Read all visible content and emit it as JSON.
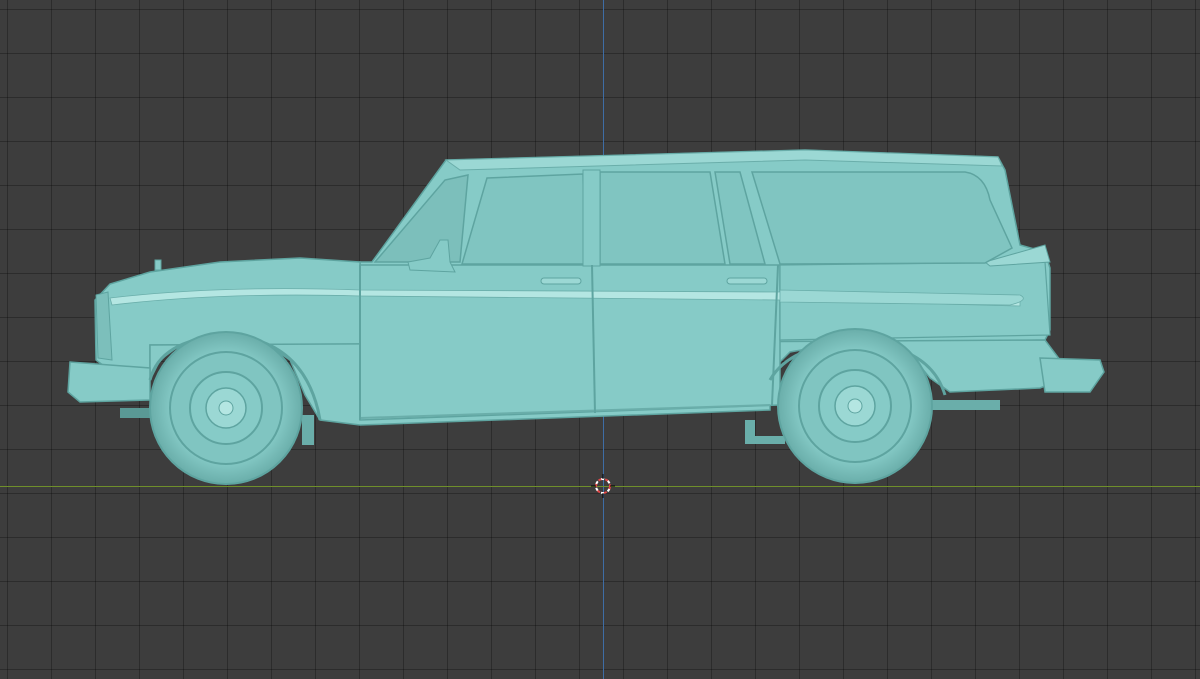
{
  "viewport": {
    "view": "right-orthographic",
    "background_color": "#3d3d3d",
    "grid_color": "#2f2f2f",
    "axis_colors": {
      "z": "#3e6da5",
      "y": "#6f8f2b"
    },
    "object": {
      "type": "station-wagon-car-model",
      "material_color": "#86cbc7",
      "shade_color": "#5ea4a0",
      "highlight_color": "#b4e6e2"
    },
    "cursor": {
      "type": "3d-cursor",
      "colors": [
        "#e04848",
        "#ffffff"
      ]
    }
  }
}
